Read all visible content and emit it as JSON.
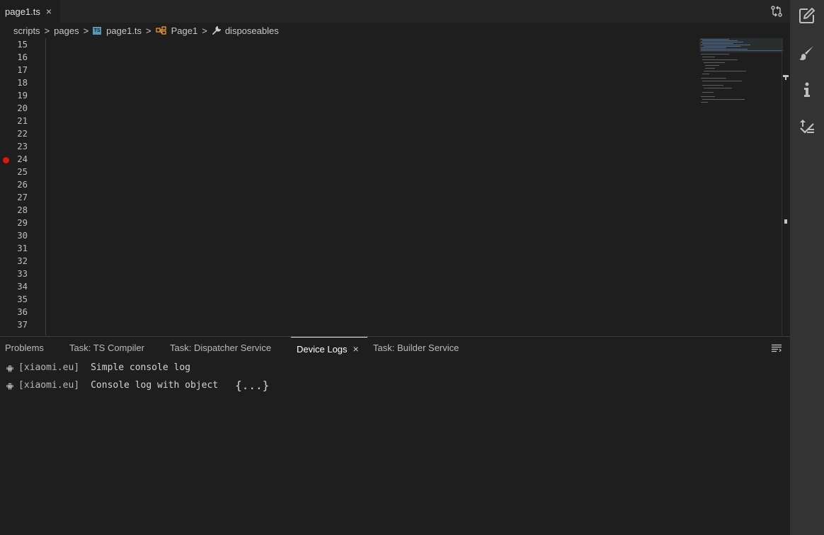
{
  "tab": {
    "filename": "page1.ts",
    "close": "×"
  },
  "breadcrumb": {
    "items": [
      "scripts",
      "pages",
      "page1.ts",
      "Page1",
      "disposeables"
    ],
    "ts_badge": "TS",
    "separator": ">"
  },
  "editor": {
    "line_numbers": [
      "15",
      "16",
      "17",
      "18",
      "19",
      "20",
      "21",
      "22",
      "23",
      "24",
      "25",
      "26",
      "27",
      "28",
      "29",
      "30",
      "31",
      "32",
      "33",
      "34",
      "35",
      "36",
      "37"
    ],
    "breakpoint_line": "24"
  },
  "panel": {
    "tabs": [
      "Problems",
      "Task: TS Compiler",
      "Task: Dispatcher Service",
      "Device Logs",
      "Task: Builder Service"
    ],
    "active_tab": "Device Logs",
    "close": "×",
    "logs": [
      {
        "source": "[xiaomi.eu]",
        "message": "Simple console log",
        "object": ""
      },
      {
        "source": "[xiaomi.eu]",
        "message": "Console log with object",
        "object": "{...}"
      }
    ]
  },
  "icons": {
    "compare": "git-compare-icon",
    "activity": [
      "edit-icon",
      "brush-icon",
      "info-icon",
      "publish-icon"
    ]
  },
  "colors": {
    "breakpoint": "#e51400",
    "comment": "#6a9955",
    "keyword": "#569cd6",
    "string": "#ce9178"
  }
}
